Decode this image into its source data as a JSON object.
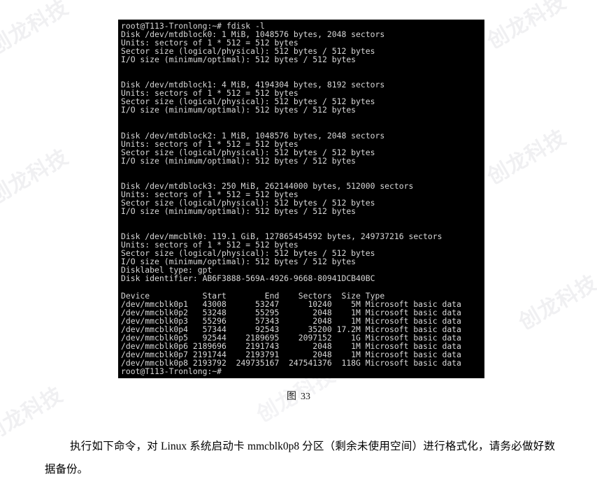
{
  "document": {
    "watermark_text": "创龙科技",
    "figure_caption": {
      "label": "图",
      "number": "33"
    },
    "paragraph": "执行如下命令，对 Linux 系统启动卡 mmcblk0p8 分区（剩余未使用空间）进行格式化，请务必做好数据备份。"
  },
  "terminal": {
    "background_color": "#000000",
    "text_color": "#d8d8d8",
    "prompt": "root@T113-Tronlong:~#",
    "command": "fdisk -l",
    "lines": [
      "root@T113-Tronlong:~# fdisk -l",
      "Disk /dev/mtdblock0: 1 MiB, 1048576 bytes, 2048 sectors",
      "Units: sectors of 1 * 512 = 512 bytes",
      "Sector size (logical/physical): 512 bytes / 512 bytes",
      "I/O size (minimum/optimal): 512 bytes / 512 bytes",
      "",
      "",
      "Disk /dev/mtdblock1: 4 MiB, 4194304 bytes, 8192 sectors",
      "Units: sectors of 1 * 512 = 512 bytes",
      "Sector size (logical/physical): 512 bytes / 512 bytes",
      "I/O size (minimum/optimal): 512 bytes / 512 bytes",
      "",
      "",
      "Disk /dev/mtdblock2: 1 MiB, 1048576 bytes, 2048 sectors",
      "Units: sectors of 1 * 512 = 512 bytes",
      "Sector size (logical/physical): 512 bytes / 512 bytes",
      "I/O size (minimum/optimal): 512 bytes / 512 bytes",
      "",
      "",
      "Disk /dev/mtdblock3: 250 MiB, 262144000 bytes, 512000 sectors",
      "Units: sectors of 1 * 512 = 512 bytes",
      "Sector size (logical/physical): 512 bytes / 512 bytes",
      "I/O size (minimum/optimal): 512 bytes / 512 bytes",
      "",
      "",
      "Disk /dev/mmcblk0: 119.1 GiB, 127865454592 bytes, 249737216 sectors",
      "Units: sectors of 1 * 512 = 512 bytes",
      "Sector size (logical/physical): 512 bytes / 512 bytes",
      "I/O size (minimum/optimal): 512 bytes / 512 bytes",
      "Disklabel type: gpt",
      "Disk identifier: AB6F3888-569A-4926-9668-80941DCB40BC",
      "",
      "Device           Start        End    Sectors  Size Type",
      "/dev/mmcblk0p1   43008      53247      10240    5M Microsoft basic data",
      "/dev/mmcblk0p2   53248      55295       2048    1M Microsoft basic data",
      "/dev/mmcblk0p3   55296      57343       2048    1M Microsoft basic data",
      "/dev/mmcblk0p4   57344      92543      35200 17.2M Microsoft basic data",
      "/dev/mmcblk0p5   92544    2189695    2097152    1G Microsoft basic data",
      "/dev/mmcblk0p6 2189696    2191743       2048    1M Microsoft basic data",
      "/dev/mmcblk0p7 2191744    2193791       2048    1M Microsoft basic data",
      "/dev/mmcblk0p8 2193792  249735167  247541376  118G Microsoft basic data",
      "root@T113-Tronlong:~#"
    ],
    "disks": [
      {
        "device": "/dev/mtdblock0",
        "size": "1 MiB",
        "bytes": "1048576",
        "sectors": "2048",
        "units": "sectors of 1 * 512 = 512 bytes",
        "sector_size": "512 bytes / 512 bytes",
        "io_size": "512 bytes / 512 bytes"
      },
      {
        "device": "/dev/mtdblock1",
        "size": "4 MiB",
        "bytes": "4194304",
        "sectors": "8192",
        "units": "sectors of 1 * 512 = 512 bytes",
        "sector_size": "512 bytes / 512 bytes",
        "io_size": "512 bytes / 512 bytes"
      },
      {
        "device": "/dev/mtdblock2",
        "size": "1 MiB",
        "bytes": "1048576",
        "sectors": "2048",
        "units": "sectors of 1 * 512 = 512 bytes",
        "sector_size": "512 bytes / 512 bytes",
        "io_size": "512 bytes / 512 bytes"
      },
      {
        "device": "/dev/mtdblock3",
        "size": "250 MiB",
        "bytes": "262144000",
        "sectors": "512000",
        "units": "sectors of 1 * 512 = 512 bytes",
        "sector_size": "512 bytes / 512 bytes",
        "io_size": "512 bytes / 512 bytes"
      },
      {
        "device": "/dev/mmcblk0",
        "size": "119.1 GiB",
        "bytes": "127865454592",
        "sectors": "249737216",
        "units": "sectors of 1 * 512 = 512 bytes",
        "sector_size": "512 bytes / 512 bytes",
        "io_size": "512 bytes / 512 bytes",
        "disklabel_type": "gpt",
        "disk_identifier": "AB6F3888-569A-4926-9668-80941DCB40BC"
      }
    ],
    "partition_table": {
      "headers": [
        "Device",
        "Start",
        "End",
        "Sectors",
        "Size",
        "Type"
      ],
      "rows": [
        [
          "/dev/mmcblk0p1",
          "43008",
          "53247",
          "10240",
          "5M",
          "Microsoft basic data"
        ],
        [
          "/dev/mmcblk0p2",
          "53248",
          "55295",
          "2048",
          "1M",
          "Microsoft basic data"
        ],
        [
          "/dev/mmcblk0p3",
          "55296",
          "57343",
          "2048",
          "1M",
          "Microsoft basic data"
        ],
        [
          "/dev/mmcblk0p4",
          "57344",
          "92543",
          "35200",
          "17.2M",
          "Microsoft basic data"
        ],
        [
          "/dev/mmcblk0p5",
          "92544",
          "2189695",
          "2097152",
          "1G",
          "Microsoft basic data"
        ],
        [
          "/dev/mmcblk0p6",
          "2189696",
          "2191743",
          "2048",
          "1M",
          "Microsoft basic data"
        ],
        [
          "/dev/mmcblk0p7",
          "2191744",
          "2193791",
          "2048",
          "1M",
          "Microsoft basic data"
        ],
        [
          "/dev/mmcblk0p8",
          "2193792",
          "249735167",
          "247541376",
          "118G",
          "Microsoft basic data"
        ]
      ]
    }
  }
}
